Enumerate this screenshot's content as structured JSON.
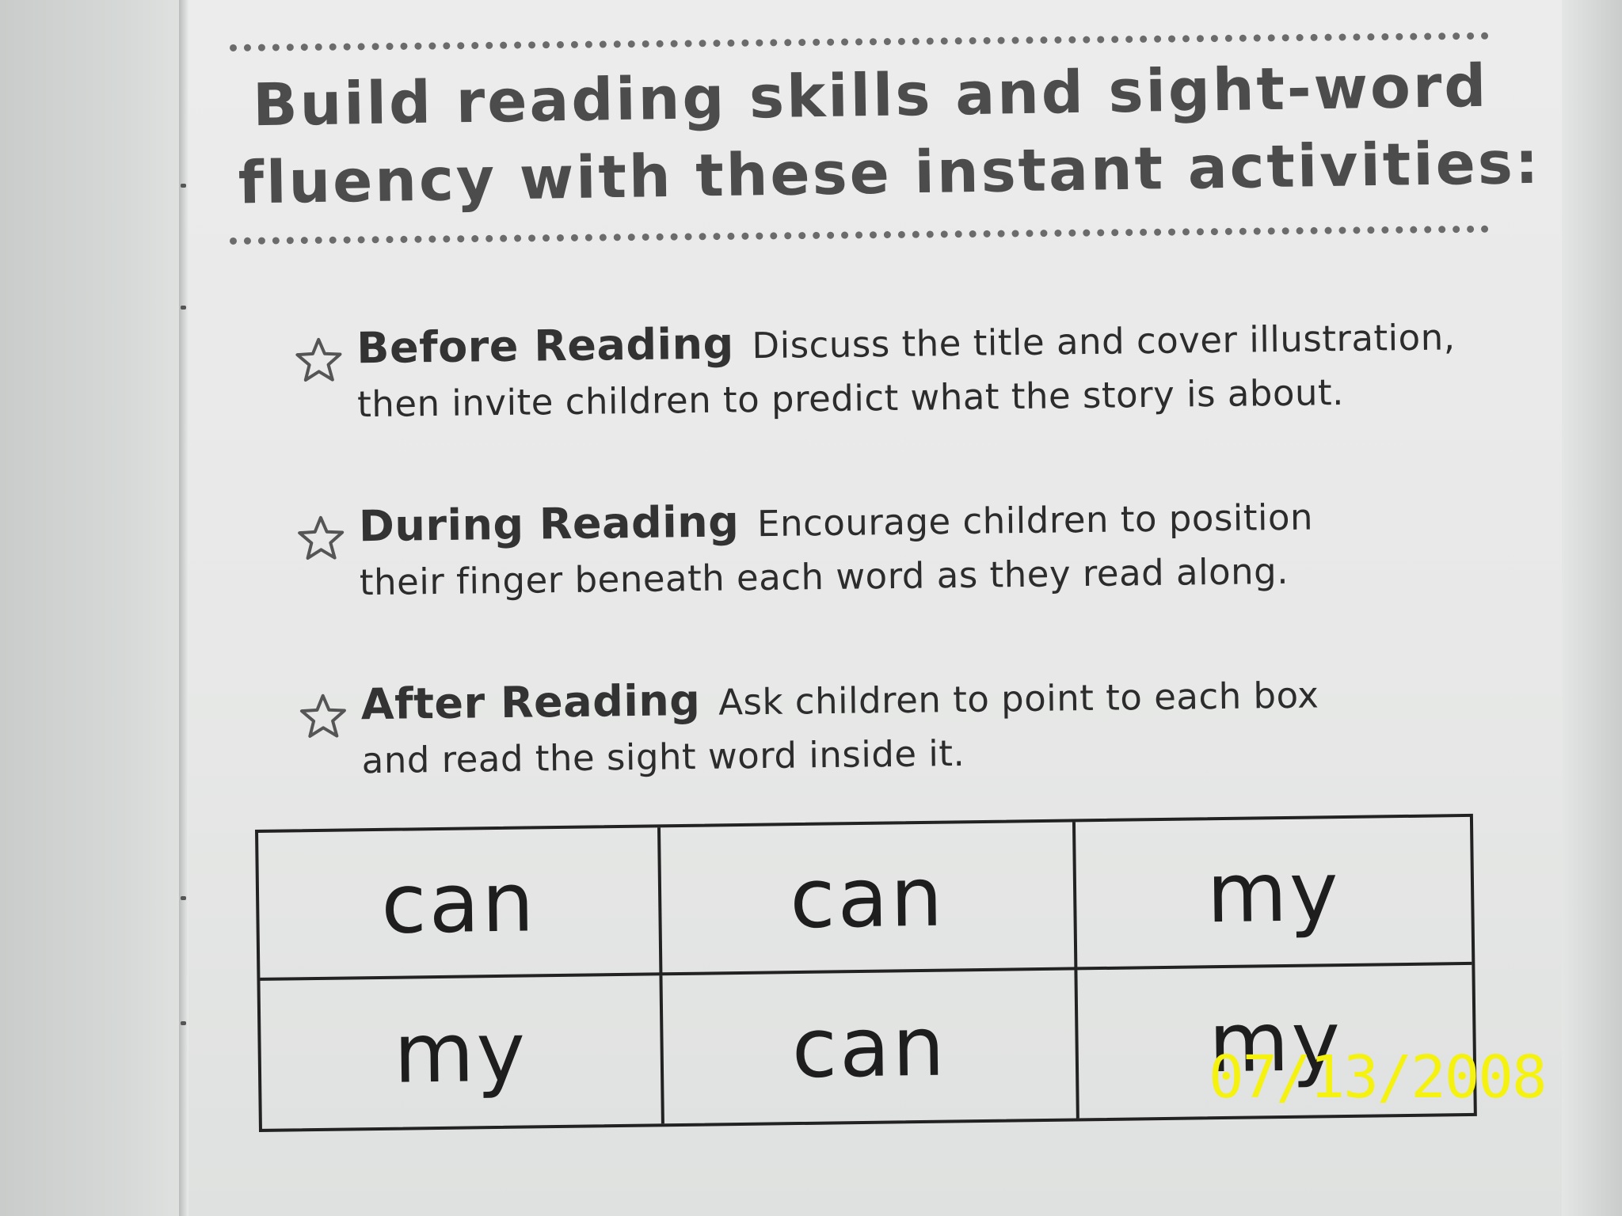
{
  "heading": {
    "line1": "Build reading skills and sight-word",
    "line2": "fluency with these instant activities:"
  },
  "activities": [
    {
      "title": "Before Reading",
      "line1": "Discuss the title and cover illustration,",
      "line2": "then invite children to predict what the story is about.",
      "icon": "star-outline-icon"
    },
    {
      "title": "During Reading",
      "line1": "Encourage children to position",
      "line2": "their finger beneath each word as they read along.",
      "icon": "star-outline-icon"
    },
    {
      "title": "After Reading",
      "line1": "Ask children to point to each box",
      "line2": "and read the sight word inside it.",
      "icon": "star-outline-icon"
    }
  ],
  "sight_word_grid": {
    "rows": [
      [
        "can",
        "can",
        "my"
      ],
      [
        "my",
        "can",
        "my"
      ]
    ]
  },
  "date_stamp": "07/13/2008",
  "colors": {
    "page": "#ececec",
    "heading_text": "#4c4c4c",
    "body_text": "#2c2c2c",
    "date_stamp": "#f4f20e"
  }
}
